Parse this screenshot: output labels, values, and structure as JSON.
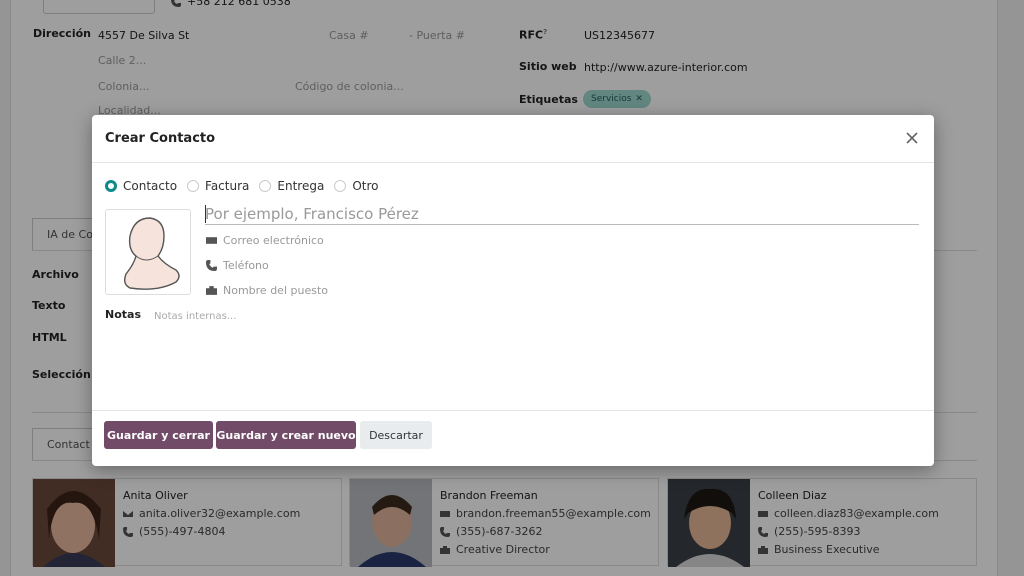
{
  "background": {
    "phone": "+58 212 681 0538",
    "address_label": "Dirección",
    "street": "4557 De Silva St",
    "house_placeholder": "Casa #",
    "door_placeholder": "- Puerta #",
    "street2_placeholder": "Calle 2...",
    "colony_placeholder": "Colonia...",
    "colony_code_placeholder": "Código de colonia...",
    "locality_placeholder": "Localidad...",
    "rfc_label": "RFC",
    "rfc_help": "?",
    "rfc_value": "US12345677",
    "website_label": "Sitio web",
    "website_value": "http://www.azure-interior.com",
    "tags_label": "Etiquetas",
    "tag_value": "Servicios",
    "tab_ia": "IA de Co",
    "archivo_label": "Archivo",
    "texto_label": "Texto",
    "html_label": "HTML",
    "seleccion_label": "Selección",
    "tab_contacts": "Contact",
    "contacts": [
      {
        "name": "Anita Oliver",
        "email": "anita.oliver32@example.com",
        "phone": "(555)-497-4804",
        "job": ""
      },
      {
        "name": "Brandon Freeman",
        "email": "brandon.freeman55@example.com",
        "phone": "(355)-687-3262",
        "job": "Creative Director"
      },
      {
        "name": "Colleen Diaz",
        "email": "colleen.diaz83@example.com",
        "phone": "(255)-595-8393",
        "job": "Business Executive"
      }
    ]
  },
  "modal": {
    "title": "Crear Contacto",
    "types": [
      "Contacto",
      "Factura",
      "Entrega",
      "Otro"
    ],
    "name_placeholder": "Por ejemplo, Francisco Pérez",
    "email_placeholder": "Correo electrónico",
    "phone_placeholder": "Teléfono",
    "job_placeholder": "Nombre del puesto",
    "notes_label": "Notas",
    "notes_placeholder": "Notas internas...",
    "save_close": "Guardar y cerrar",
    "save_new": "Guardar y crear nuevo",
    "discard": "Descartar"
  },
  "colors": {
    "primary": "#714b67",
    "radio_accent": "#0e8a8a",
    "tag_bg": "#9fd8cf"
  }
}
